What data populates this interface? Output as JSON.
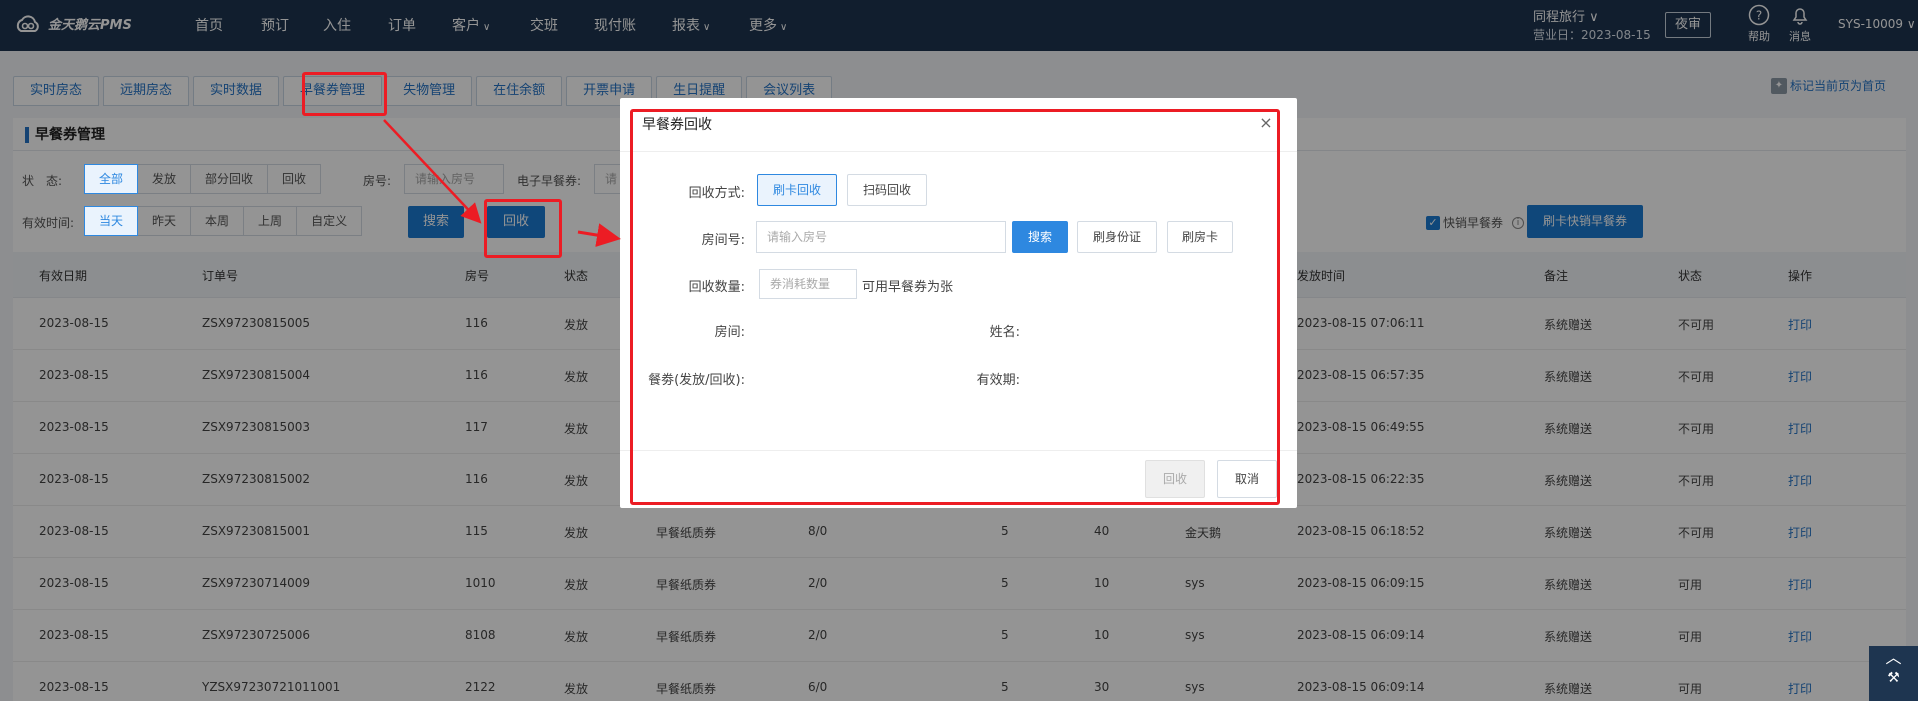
{
  "app": {
    "logo_text": "金天鹅云PMS"
  },
  "topnav": {
    "items": [
      {
        "label": "首页",
        "has_caret": false
      },
      {
        "label": "预订",
        "has_caret": false
      },
      {
        "label": "入住",
        "has_caret": false
      },
      {
        "label": "订单",
        "has_caret": false
      },
      {
        "label": "客户",
        "has_caret": true
      },
      {
        "label": "交班",
        "has_caret": false
      },
      {
        "label": "现付账",
        "has_caret": false
      },
      {
        "label": "报表",
        "has_caret": true
      },
      {
        "label": "更多",
        "has_caret": true
      }
    ],
    "caret": "∨",
    "hotel": "同程旅行 ∨",
    "business_date": "营业日：2023-08-15",
    "night_audit": "夜审",
    "help": "帮助",
    "messages": "消息",
    "user": "SYS-10009 ∨"
  },
  "tabs": [
    "实时房态",
    "远期房态",
    "实时数据",
    "早餐券管理",
    "失物管理",
    "在住余额",
    "开票申请",
    "生日提醒",
    "会议列表"
  ],
  "mark_home": "标记当前页为首页",
  "panel": {
    "title": "早餐券管理",
    "status_label": "状　态:",
    "status_options": [
      "全部",
      "发放",
      "部分回收",
      "回收"
    ],
    "room_label": "房号:",
    "room_placeholder": "请输入房号",
    "ecoupon_label": "电子早餐券:",
    "ecoupon_placeholder": "请",
    "valid_label": "有效时间:",
    "valid_options": [
      "当天",
      "昨天",
      "本周",
      "上周",
      "自定义"
    ],
    "search_button": "搜索",
    "recycle_button": "回收",
    "quick_checkbox_label": "快销早餐券",
    "quick_button": "刷卡快销早餐券"
  },
  "table": {
    "headers": [
      "有效日期",
      "订单号",
      "房号",
      "状态",
      "发放时间",
      "备注",
      "状态",
      "操作"
    ],
    "rows": [
      {
        "date": "2023-08-15",
        "order": "ZSX97230815005",
        "room": "116",
        "status": "发放",
        "type": "",
        "count": "",
        "num": "",
        "price": "",
        "op_user": "",
        "time": "2023-08-15 07:06:11",
        "remark": "系统赠送",
        "state": "不可用",
        "action": "打印"
      },
      {
        "date": "2023-08-15",
        "order": "ZSX97230815004",
        "room": "116",
        "status": "发放",
        "type": "",
        "count": "",
        "num": "",
        "price": "",
        "op_user": "",
        "time": "2023-08-15 06:57:35",
        "remark": "系统赠送",
        "state": "不可用",
        "action": "打印"
      },
      {
        "date": "2023-08-15",
        "order": "ZSX97230815003",
        "room": "117",
        "status": "发放",
        "type": "",
        "count": "",
        "num": "",
        "price": "",
        "op_user": "",
        "time": "2023-08-15 06:49:55",
        "remark": "系统赠送",
        "state": "不可用",
        "action": "打印"
      },
      {
        "date": "2023-08-15",
        "order": "ZSX97230815002",
        "room": "116",
        "status": "发放",
        "type": "",
        "count": "",
        "num": "",
        "price": "",
        "op_user": "",
        "time": "2023-08-15 06:22:35",
        "remark": "系统赠送",
        "state": "不可用",
        "action": "打印"
      },
      {
        "date": "2023-08-15",
        "order": "ZSX97230815001",
        "room": "115",
        "status": "发放",
        "type": "早餐纸质券",
        "count": "8/0",
        "num": "5",
        "price": "40",
        "op_user": "金天鹅",
        "time": "2023-08-15 06:18:52",
        "remark": "系统赠送",
        "state": "不可用",
        "action": "打印"
      },
      {
        "date": "2023-08-15",
        "order": "ZSX97230714009",
        "room": "1010",
        "status": "发放",
        "type": "早餐纸质券",
        "count": "2/0",
        "num": "5",
        "price": "10",
        "op_user": "sys",
        "time": "2023-08-15 06:09:15",
        "remark": "系统赠送",
        "state": "可用",
        "action": "打印"
      },
      {
        "date": "2023-08-15",
        "order": "ZSX97230725006",
        "room": "8108",
        "status": "发放",
        "type": "早餐纸质券",
        "count": "2/0",
        "num": "5",
        "price": "10",
        "op_user": "sys",
        "time": "2023-08-15 06:09:14",
        "remark": "系统赠送",
        "state": "可用",
        "action": "打印"
      },
      {
        "date": "2023-08-15",
        "order": "YZSX97230721011001",
        "room": "2122",
        "status": "发放",
        "type": "早餐纸质券",
        "count": "6/0",
        "num": "5",
        "price": "30",
        "op_user": "sys",
        "time": "2023-08-15 06:09:14",
        "remark": "系统赠送",
        "state": "可用",
        "action": "打印"
      }
    ]
  },
  "dialog": {
    "title": "早餐券回收",
    "close": "×",
    "method_label": "回收方式:",
    "method_card": "刷卡回收",
    "method_scan": "扫码回收",
    "room_label": "房间号:",
    "room_placeholder": "请输入房号",
    "search": "搜索",
    "read_id": "刷身份证",
    "read_card": "刷房卡",
    "qty_label": "回收数量:",
    "qty_placeholder": "券消耗数量",
    "qty_hint": "可用早餐券为张",
    "info_room": "房间:",
    "info_name": "姓名:",
    "info_coupon": "餐劵(发放/回收):",
    "info_valid": "有效期:",
    "recycle": "回收",
    "cancel": "取消"
  },
  "colors": {
    "nav_bg": "#1e3550",
    "accent": "#1b7ad3",
    "annotation": "#ec1c24"
  }
}
